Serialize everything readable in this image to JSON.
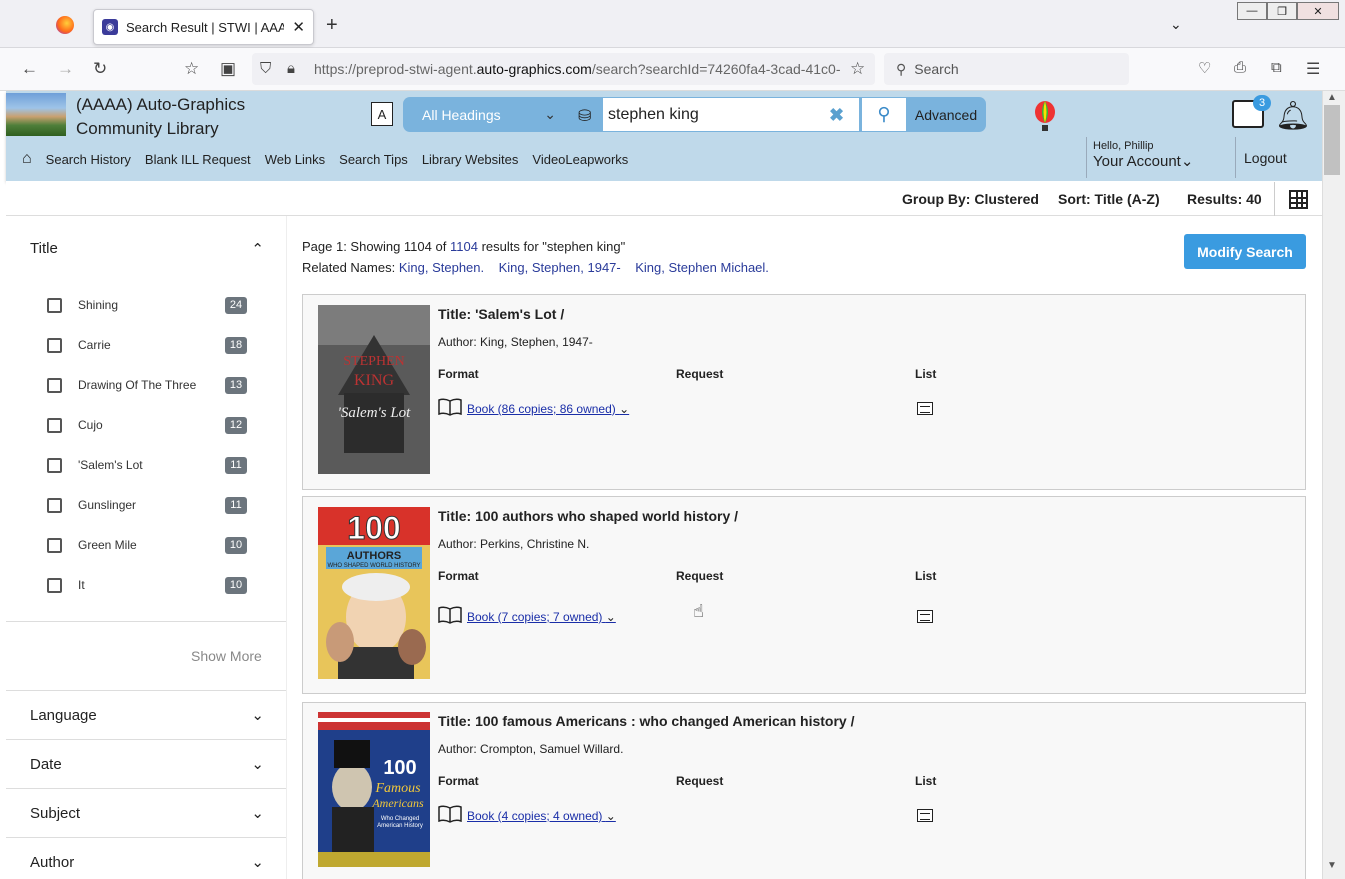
{
  "browser": {
    "tab_title": "Search Result | STWI | AAAA | Auto-Graphics",
    "url_prefix": "https://preprod-stwi-agent.",
    "url_domain": "auto-graphics.com",
    "url_suffix": "/search?searchId=74260fa4-3cad-41c0-",
    "search_placeholder": "Search"
  },
  "header": {
    "library_name_line1": "(AAAA) Auto-Graphics",
    "library_name_line2": "Community Library",
    "heading_select": "All Headings",
    "query": "stephen king",
    "advanced_label": "Advanced",
    "list_badge": "3",
    "hello": "Hello, Phillip",
    "your_account": "Your Account",
    "logout": "Logout"
  },
  "menu": [
    "Search History",
    "Blank ILL Request",
    "Web Links",
    "Search Tips",
    "Library Websites",
    "VideoLeapworks"
  ],
  "results_bar": {
    "group_by": "Group By: Clustered",
    "sort": "Sort: Title (A-Z)",
    "results": "Results: 40"
  },
  "facets": {
    "title_label": "Title",
    "title_items": [
      {
        "label": "Shining",
        "count": "24"
      },
      {
        "label": "Carrie",
        "count": "18"
      },
      {
        "label": "Drawing Of The Three",
        "count": "13"
      },
      {
        "label": "Cujo",
        "count": "12"
      },
      {
        "label": "'Salem's Lot",
        "count": "11"
      },
      {
        "label": "Gunslinger",
        "count": "11"
      },
      {
        "label": "Green Mile",
        "count": "10"
      },
      {
        "label": "It",
        "count": "10"
      }
    ],
    "show_more": "Show More",
    "language": "Language",
    "date": "Date",
    "subject": "Subject",
    "author": "Author"
  },
  "summary": {
    "page_text": "Page 1: Showing",
    "showing": "1104",
    "of": "of",
    "total": "1104",
    "results_for": "results for \"stephen king\"",
    "related_label": "Related Names:",
    "related": [
      "King, Stephen.",
      "King, Stephen, 1947-",
      "King, Stephen Michael."
    ],
    "modify_label": "Modify Search"
  },
  "columns": {
    "format": "Format",
    "request": "Request",
    "list": "List"
  },
  "results": [
    {
      "title": "Title: 'Salem's Lot /",
      "author": "Author: King, Stephen, 1947-",
      "format": "Book (86 copies; 86 owned)",
      "cover_text": "STEPHEN KING 'Salem's Lot"
    },
    {
      "title": "Title: 100 authors who shaped world history /",
      "author": "Author: Perkins, Christine N.",
      "format": "Book (7 copies; 7 owned)",
      "cover_text": "100 AUTHORS WHO SHAPED WORLD HISTORY"
    },
    {
      "title": "Title: 100 famous Americans : who changed American history /",
      "author": "Author: Crompton, Samuel Willard.",
      "format": "Book (4 copies; 4 owned)",
      "cover_text": "100 Famous Americans Who Changed American History"
    }
  ]
}
